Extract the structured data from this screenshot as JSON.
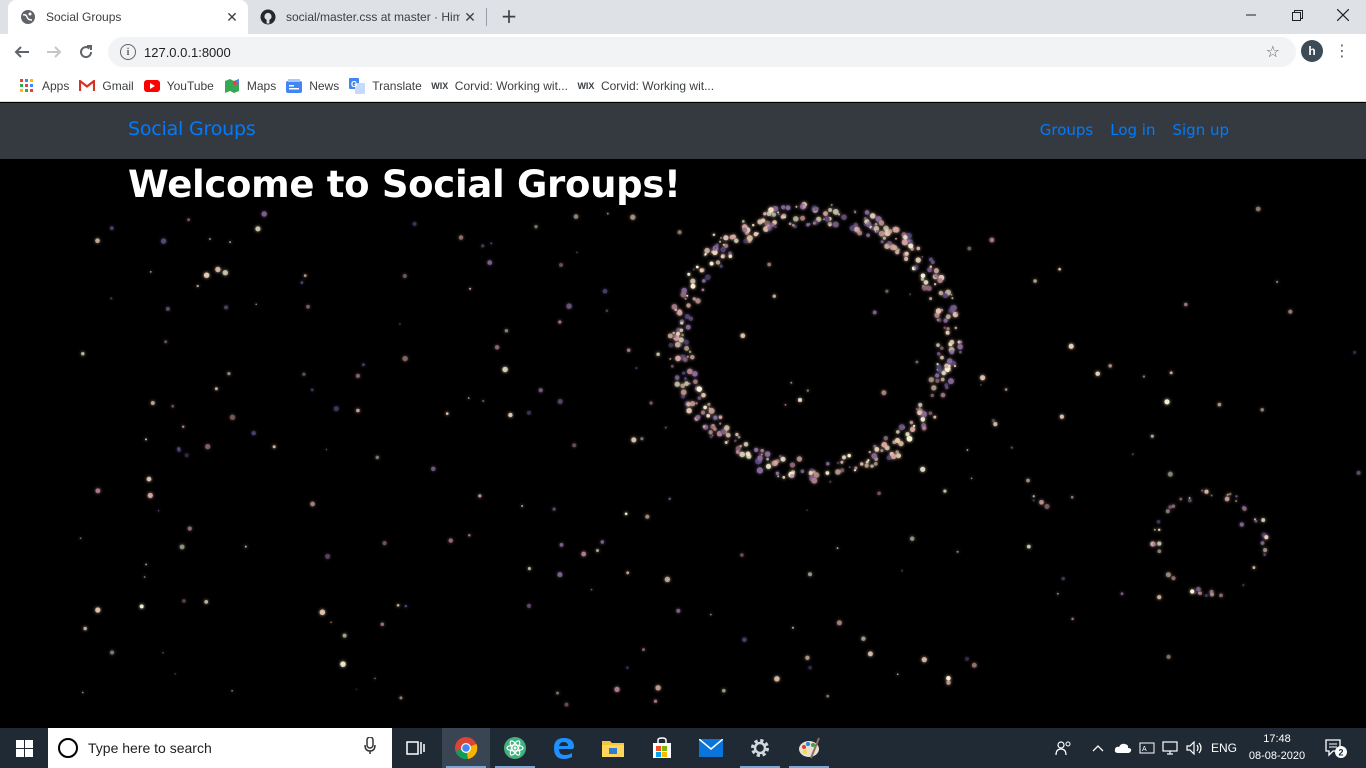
{
  "browser": {
    "tabs": [
      {
        "title": "Social Groups",
        "icon": "globe-icon",
        "active": true
      },
      {
        "title": "social/master.css at master · Him",
        "icon": "github-icon",
        "active": false
      }
    ],
    "url": "127.0.0.1:8000",
    "profile_initial": "h",
    "bookmarks": [
      {
        "label": "Apps",
        "icon": "apps-grid-icon"
      },
      {
        "label": "Gmail",
        "icon": "gmail-icon"
      },
      {
        "label": "YouTube",
        "icon": "youtube-icon"
      },
      {
        "label": "Maps",
        "icon": "maps-icon"
      },
      {
        "label": "News",
        "icon": "news-icon"
      },
      {
        "label": "Translate",
        "icon": "translate-icon"
      },
      {
        "label": "Corvid: Working wit...",
        "icon": "wix-icon"
      },
      {
        "label": "Corvid: Working wit...",
        "icon": "wix-icon"
      }
    ],
    "wix_text": "WIX"
  },
  "site": {
    "brand": "Social Groups",
    "nav": [
      "Groups",
      "Log in",
      "Sign up"
    ],
    "heading": "Welcome to Social Groups!",
    "colors": {
      "navbar": "#343a40",
      "link": "#007bff",
      "background": "#000000"
    }
  },
  "taskbar": {
    "search_placeholder": "Type here to search",
    "language": "ENG",
    "time": "17:48",
    "date": "08-08-2020",
    "notification_count": "2"
  }
}
